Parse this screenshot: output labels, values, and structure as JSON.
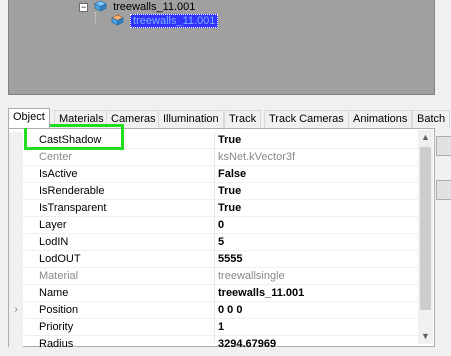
{
  "tree": {
    "nodes": [
      {
        "label": "treewalls_11.001",
        "selected": false
      },
      {
        "label": "treewalls_11.001",
        "selected": true
      }
    ]
  },
  "tabs": [
    "Object",
    "Materials",
    "Cameras",
    "Illumination",
    "Track",
    "Track Cameras",
    "Animations",
    "Batch"
  ],
  "active_tab": "Object",
  "properties": [
    {
      "name": "CastShadow",
      "value": "True",
      "dim": false,
      "expandable": false
    },
    {
      "name": "Center",
      "value": "ksNet.kVector3f",
      "dim": true,
      "expandable": false
    },
    {
      "name": "IsActive",
      "value": "False",
      "dim": false,
      "expandable": false
    },
    {
      "name": "IsRenderable",
      "value": "True",
      "dim": false,
      "expandable": false
    },
    {
      "name": "IsTransparent",
      "value": "True",
      "dim": false,
      "expandable": false
    },
    {
      "name": "Layer",
      "value": "0",
      "dim": false,
      "expandable": false
    },
    {
      "name": "LodIN",
      "value": "5",
      "dim": false,
      "expandable": false
    },
    {
      "name": "LodOUT",
      "value": "5555",
      "dim": false,
      "expandable": false
    },
    {
      "name": "Material",
      "value": "treewallsingle",
      "dim": true,
      "expandable": false
    },
    {
      "name": "Name",
      "value": "treewalls_11.001",
      "dim": false,
      "expandable": false
    },
    {
      "name": "Position",
      "value": "0 0 0",
      "dim": false,
      "expandable": true
    },
    {
      "name": "Priority",
      "value": "1",
      "dim": false,
      "expandable": false
    },
    {
      "name": "Radius",
      "value": "3294.67969",
      "dim": false,
      "expandable": false
    }
  ],
  "icons": {
    "expand": "chevron-right-icon",
    "cube": "cube-icon",
    "collapse": "tree-collapse-icon"
  },
  "colors": {
    "highlight": "#22dd22",
    "selection": "#3333ff"
  }
}
